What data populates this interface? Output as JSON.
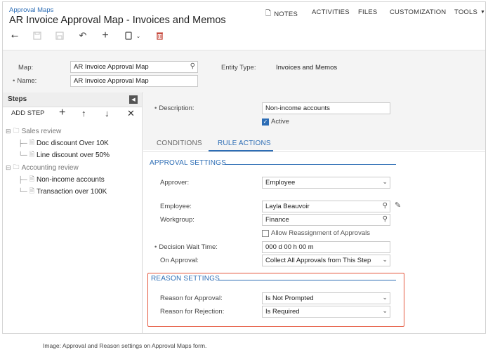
{
  "breadcrumb": "Approval Maps",
  "title": "AR Invoice Approval Map - Invoices and Memos",
  "topnav": {
    "notes": "NOTES",
    "activities": "ACTIVITIES",
    "files": "FILES",
    "customization": "CUSTOMIZATION",
    "tools": "TOOLS"
  },
  "toolbar_icons": [
    "undo-icon",
    "save-close-icon",
    "save-icon",
    "cancel-icon",
    "add-icon",
    "copy-paste-icon",
    "delete-icon"
  ],
  "header": {
    "map_label": "Map:",
    "map_value": "AR Invoice Approval Map",
    "name_label": "Name:",
    "name_value": "AR Invoice Approval Map",
    "entity_type_label": "Entity Type:",
    "entity_type_value": "Invoices and Memos"
  },
  "steps": {
    "title": "Steps",
    "add_step": "ADD STEP",
    "tree": [
      {
        "label": "Sales review",
        "type": "group"
      },
      {
        "label": "Doc discount Over 10K",
        "type": "leaf"
      },
      {
        "label": "Line discount over 50%",
        "type": "leaf"
      },
      {
        "label": "Accounting review",
        "type": "group"
      },
      {
        "label": "Non-income accounts",
        "type": "leaf"
      },
      {
        "label": "Transaction over 100K",
        "type": "leaf"
      }
    ]
  },
  "rule": {
    "description_label": "Description:",
    "description_value": "Non-income accounts",
    "active_label": "Active",
    "active_checked": true
  },
  "tabs": {
    "conditions": "CONDITIONS",
    "rule_actions": "RULE ACTIONS",
    "active": "rule_actions"
  },
  "approval": {
    "section_title": "APPROVAL SETTINGS",
    "approver_label": "Approver:",
    "approver_value": "Employee",
    "employee_label": "Employee:",
    "employee_value": "Layla Beauvoir",
    "workgroup_label": "Workgroup:",
    "workgroup_value": "Finance",
    "allow_reassign_label": "Allow Reassignment of Approvals",
    "allow_reassign_checked": false,
    "wait_time_label": "Decision Wait Time:",
    "wait_time_value": "000 d 00 h 00 m",
    "on_approval_label": "On Approval:",
    "on_approval_value": "Collect All Approvals from This Step"
  },
  "reason": {
    "section_title": "REASON SETTINGS",
    "approval_label": "Reason for Approval:",
    "approval_value": "Is Not Prompted",
    "rejection_label": "Reason for Rejection:",
    "rejection_value": "Is Required"
  },
  "caption": "Image: Approval and Reason settings on Approval Maps form.",
  "colors": {
    "accent": "#2d6db5",
    "highlight": "#e4573d",
    "panel": "#f4f4f4"
  }
}
